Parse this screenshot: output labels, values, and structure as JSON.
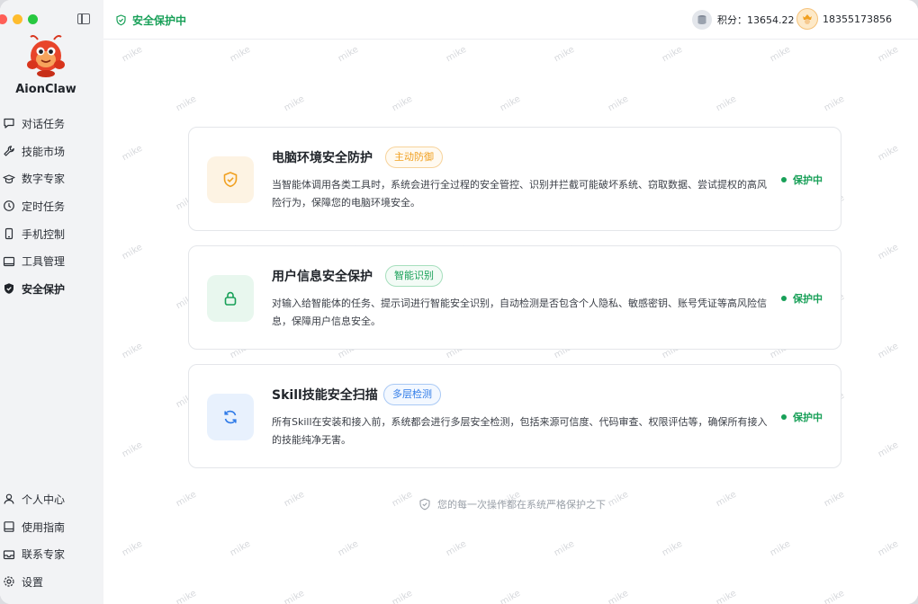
{
  "app": {
    "name": "AionClaw"
  },
  "sidebar": {
    "nav_top": [
      {
        "label": "对话任务",
        "icon": "chat-icon"
      },
      {
        "label": "技能市场",
        "icon": "wrench-icon"
      },
      {
        "label": "数字专家",
        "icon": "graduation-cap-icon"
      },
      {
        "label": "定时任务",
        "icon": "clock-icon"
      },
      {
        "label": "手机控制",
        "icon": "phone-icon"
      },
      {
        "label": "工具管理",
        "icon": "toolbox-icon"
      },
      {
        "label": "安全保护",
        "icon": "shield-icon",
        "active": true
      }
    ],
    "nav_bottom": [
      {
        "label": "个人中心",
        "icon": "user-icon"
      },
      {
        "label": "使用指南",
        "icon": "book-icon"
      },
      {
        "label": "联系专家",
        "icon": "mail-icon"
      },
      {
        "label": "设置",
        "icon": "gear-icon"
      }
    ]
  },
  "header": {
    "security_status": "安全保护中",
    "points_label": "积分：13654.22",
    "user_phone": "18355173856"
  },
  "cards": [
    {
      "title": "电脑环境安全防护",
      "tag": "主动防御",
      "description": "当智能体调用各类工具时，系统会进行全过程的安全管控、识别并拦截可能破坏系统、窃取数据、尝试提权的高风险行为，保障您的电脑环境安全。",
      "status": "保护中",
      "icon": "shield-check-icon",
      "accent": "#f0a020"
    },
    {
      "title": "用户信息安全保护",
      "tag": "智能识别",
      "description": "对输入给智能体的任务、提示词进行智能安全识别，自动检测是否包含个人隐私、敏感密钥、账号凭证等高风险信息，保障用户信息安全。",
      "status": "保护中",
      "icon": "lock-icon",
      "accent": "#18a058"
    },
    {
      "title": "Skill技能安全扫描",
      "tag": "多层检测",
      "description": "所有Skill在安装和接入前，系统都会进行多层安全检测，包括来源可信度、代码审查、权限评估等，确保所有接入的技能纯净无害。",
      "status": "保护中",
      "icon": "refresh-icon",
      "accent": "#2f7be8"
    }
  ],
  "footer": {
    "note": "您的每一次操作都在系统严格保护之下"
  },
  "watermark": "mike"
}
